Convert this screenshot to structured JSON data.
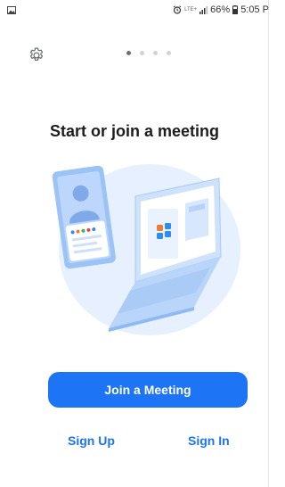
{
  "status_bar": {
    "lte_label": "LTE+",
    "battery": "66%",
    "time": "5:05 P",
    "icons": [
      "image-icon",
      "alarm-icon",
      "signal-icon",
      "battery-icon"
    ]
  },
  "onboarding": {
    "page_count": 4,
    "active_page": 1,
    "title": "Start or join a meeting"
  },
  "actions": {
    "join_label": "Join a Meeting",
    "sign_up_label": "Sign Up",
    "sign_in_label": "Sign In"
  },
  "colors": {
    "primary": "#1d74f5",
    "illustration_bg": "#e6f0fe",
    "tile_orange": "#f07b2c",
    "tile_blue": "#2d8cf0"
  }
}
